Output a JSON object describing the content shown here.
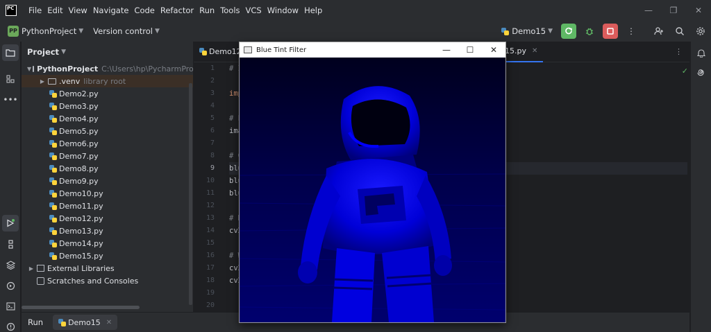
{
  "menubar": {
    "logo_text": "PC",
    "items": [
      "File",
      "Edit",
      "View",
      "Navigate",
      "Code",
      "Refactor",
      "Run",
      "Tools",
      "VCS",
      "Window",
      "Help"
    ],
    "window_controls": [
      "—",
      "❐",
      "✕"
    ]
  },
  "toolbar": {
    "project_badge": "PP",
    "project_name": "PythonProject",
    "version_control": "Version control",
    "run_config": "Demo15"
  },
  "project_pane": {
    "title": "Project",
    "root_name": "PythonProject",
    "root_path": "C:\\Users\\hp\\PycharmProjects",
    "venv_name": ".venv",
    "venv_note": "library root",
    "files": [
      "Demo2.py",
      "Demo3.py",
      "Demo4.py",
      "Demo5.py",
      "Demo6.py",
      "Demo7.py",
      "Demo8.py",
      "Demo9.py",
      "Demo10.py",
      "Demo11.py",
      "Demo12.py",
      "Demo13.py",
      "Demo14.py",
      "Demo15.py"
    ],
    "external_libraries": "External Libraries",
    "scratches": "Scratches and Consoles"
  },
  "editor": {
    "tabs": [
      {
        "label": "Demo12."
      },
      {
        "label": "15.py"
      }
    ],
    "line_numbers": [
      "1",
      "2",
      "3",
      "4",
      "5",
      "6",
      "7",
      "8",
      "9",
      "10",
      "11",
      "12",
      "13",
      "14",
      "15",
      "16",
      "17",
      "18",
      "19",
      "20"
    ],
    "current_line": "9",
    "code_lines": [
      "# I",
      "",
      "imp",
      "",
      "# L",
      "ima",
      "",
      "# C",
      "blu",
      "blu",
      "blu",
      "",
      "# D",
      "cv2",
      "",
      "# W",
      "cv2",
      "cv2",
      "",
      ""
    ]
  },
  "bottom_bar": {
    "run_label": "Run",
    "run_tab": "Demo15"
  },
  "cv_window": {
    "title": "Blue Tint Filter",
    "controls": [
      "—",
      "☐",
      "✕"
    ]
  },
  "colors": {
    "tint_blue": "#0000ff",
    "ide_bg": "#1e1f22",
    "panel_bg": "#2b2d30",
    "selection": "#3b2f26",
    "accent": "#3574f0"
  }
}
